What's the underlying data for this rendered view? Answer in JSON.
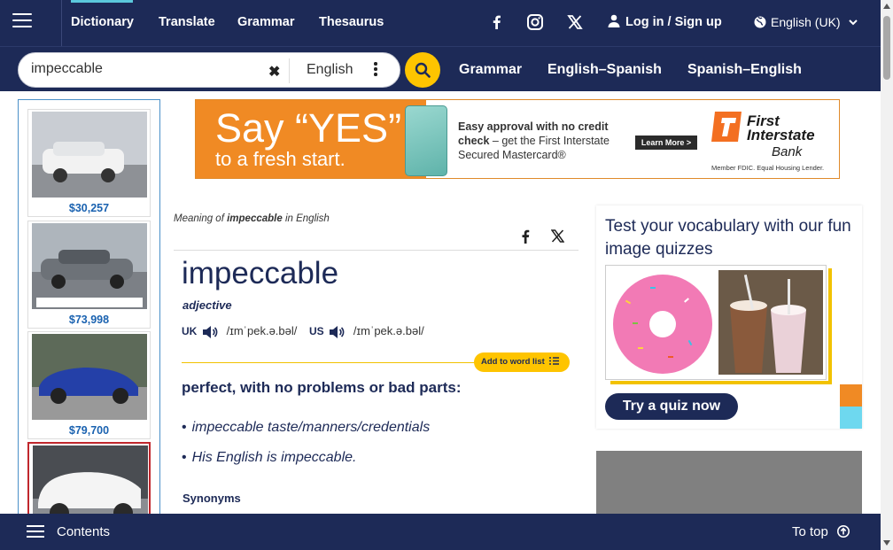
{
  "topnav": {
    "links": [
      "Dictionary",
      "Translate",
      "Grammar",
      "Thesaurus"
    ],
    "login_label": "Log in / Sign up",
    "language": "English (UK)",
    "social_icons": [
      "facebook-icon",
      "instagram-icon",
      "x-icon"
    ]
  },
  "search": {
    "value": "impeccable",
    "language": "English",
    "links": [
      "Grammar",
      "English–Spanish",
      "Spanish–English"
    ]
  },
  "cars": [
    {
      "price": "$30,257"
    },
    {
      "price": "$73,998"
    },
    {
      "price": "$79,700"
    },
    {
      "price": ""
    }
  ],
  "ad": {
    "headline": "Say “YES”",
    "subhead": "to a fresh start.",
    "body_bold": "Easy approval with no credit check",
    "body_rest": " – get the First Interstate Secured Mastercard®",
    "cta": "Learn More >",
    "brand_line1": "First",
    "brand_line2": "Interstate",
    "brand_line3": "Bank",
    "fineprint": "Member FDIC. Equal Housing Lender."
  },
  "entry": {
    "meaning_prefix": "Meaning of ",
    "meaning_word": "impeccable",
    "meaning_suffix": " in English",
    "headword": "impeccable",
    "pos": "adjective",
    "uk_label": "UK",
    "uk_ipa": "/ɪmˈpek.ə.bəl/",
    "us_label": "US",
    "us_ipa": "/ɪmˈpek.ə.bəl/",
    "add_to_list": "Add to word list",
    "definition": "perfect, with no problems or bad parts:",
    "examples": [
      "impeccable taste/manners/credentials",
      "His English is impeccable."
    ],
    "synonyms_label": "Synonyms"
  },
  "quiz": {
    "title": "Test your vocabulary with our fun image quizzes",
    "button": "Try a quiz now"
  },
  "bottombar": {
    "contents": "Contents",
    "to_top": "To top"
  },
  "colors": {
    "navy": "#1d2a57",
    "yellow": "#fec400",
    "price_blue": "#1a62b0",
    "ad_orange": "#f08a24"
  }
}
